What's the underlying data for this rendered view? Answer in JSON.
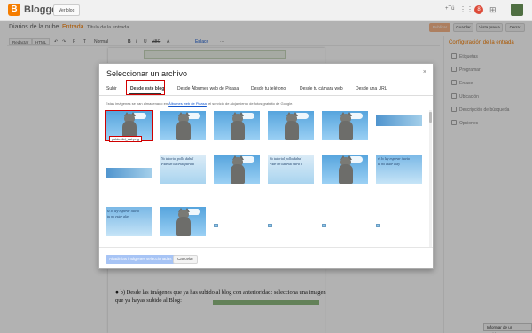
{
  "app": {
    "brand": "Blogger",
    "view_blog": "Ver blog",
    "plus_user": "+Tú",
    "notifications": "8"
  },
  "post": {
    "blog_name": "Diarios de la nube",
    "separator": "·",
    "entry_label": "Entrada",
    "title_placeholder": "Título de la entrada"
  },
  "actions": {
    "publish": "Publicar",
    "save": "Guardar",
    "preview": "Vista previa",
    "close": "Cerrar"
  },
  "toolbar": {
    "compose": "Redactar",
    "html": "HTML",
    "undo": "↶",
    "redo": "↷",
    "font": "F",
    "size": "T",
    "format": "Normal",
    "bold": "B",
    "italic": "I",
    "underline": "U",
    "strike": "ABC",
    "text_color": "A",
    "link": "Enlace",
    "more": "···"
  },
  "sidebar": {
    "title": "Configuración de la entrada",
    "items": [
      "Etiquetas",
      "Programar",
      "Enlace",
      "Ubicación",
      "Descripción de búsqueda",
      "Opciones"
    ]
  },
  "dialog": {
    "title": "Seleccionar un archivo",
    "close": "×",
    "tabs": [
      "Subir",
      "Desde este blog",
      "Desde Álbumes web de Picasa",
      "Desde tu teléfono",
      "Desde tu cámara web",
      "Desde una URL"
    ],
    "active_tab": "Desde este blog",
    "desc_before": "Estas imágenes se han almacenado en ",
    "desc_link": "Álbumes web de Picasa",
    "desc_after": ", el servicio de alojamiento de fotos gratuito de Google.",
    "selected_file": "yoldeclid_cat.png",
    "text_thumb_lines": [
      "Yo tutorial pollo dabal",
      "Pide un tutorial para ti"
    ],
    "light_thumb_lines": [
      "si lo ley esperar iluvia",
      "tu no estar alay"
    ],
    "add_button": "Añadir las imágenes seleccionadas",
    "cancel_button": "Cancelar"
  },
  "editor": {
    "bullet": "b) Desde las imágenes que ya has subido al blog con anterioridad: selecciona una imagen que ya hayas subido al Blog:"
  },
  "report": "Informar de un problema"
}
